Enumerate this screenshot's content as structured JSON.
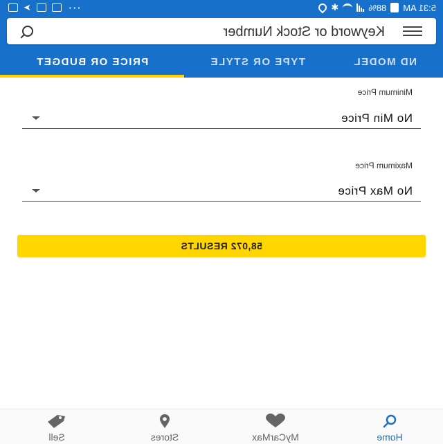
{
  "status_bar": {
    "time": "5:31 AM",
    "battery": "88%"
  },
  "search": {
    "placeholder": "Keyword or Stock Number"
  },
  "tabs": [
    {
      "label": "ND MODEL",
      "active": false
    },
    {
      "label": "TYPE OR STYLE",
      "active": false
    },
    {
      "label": "PRICE OR BUDGET",
      "active": true
    }
  ],
  "filters": {
    "min_price": {
      "label": "Minimum Price",
      "value": "No Min Price"
    },
    "max_price": {
      "label": "Maximum Price",
      "value": "No Max Price"
    }
  },
  "results_button": {
    "label": "58,072 RESULTS"
  },
  "bottom_nav": [
    {
      "label": "Home",
      "icon": "search-icon",
      "active": true
    },
    {
      "label": "MyCarMax",
      "icon": "heart-icon",
      "active": false
    },
    {
      "label": "Stores",
      "icon": "location-pin-icon",
      "active": false
    },
    {
      "label": "Sell",
      "icon": "tag-icon",
      "active": false
    }
  ],
  "colors": {
    "brand_blue": "#1770c9",
    "accent_yellow": "#ffd600"
  }
}
